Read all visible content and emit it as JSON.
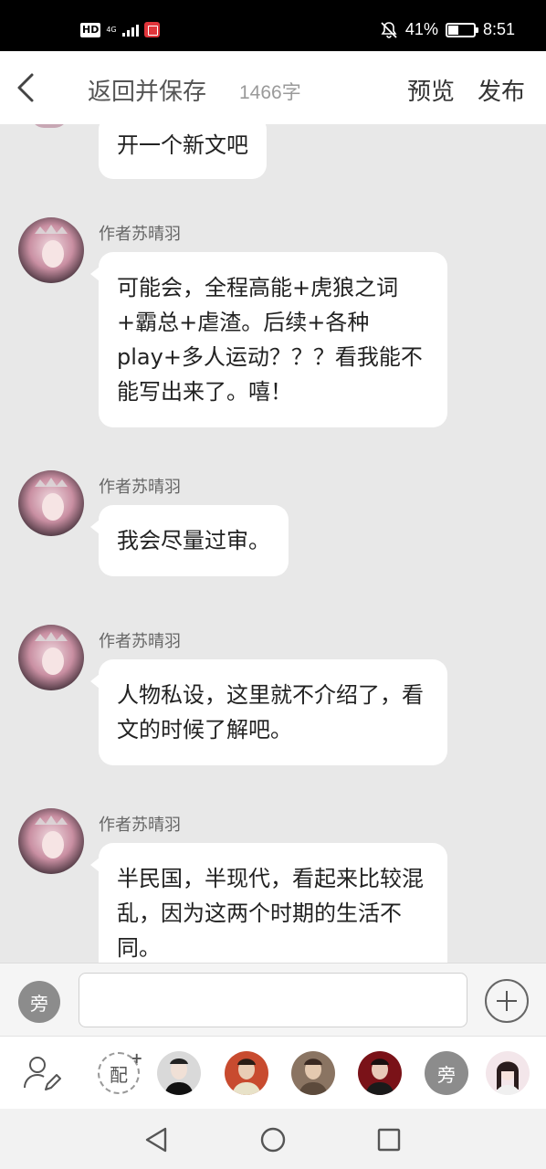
{
  "status_bar": {
    "hd_label": "HD",
    "network_label": "4G",
    "battery_percent": "41%",
    "battery_level": 0.41,
    "time": "8:51",
    "icons": [
      "hd-icon",
      "signal-icon",
      "notification-app-icon",
      "mute-bell-icon",
      "battery-icon"
    ]
  },
  "header": {
    "back_icon": "chevron-left-icon",
    "title": "返回并保存",
    "word_count": "1466字",
    "preview_label": "预览",
    "publish_label": "发布"
  },
  "chat": {
    "first_bubble": "开一个新文吧",
    "messages": [
      {
        "author": "作者苏晴羽",
        "text": "可能会，全程高能+虎狼之词+霸总+虐渣。后续+各种play+多人运动？？？看我能不能写出来了。嘻！"
      },
      {
        "author": "作者苏晴羽",
        "text": "我会尽量过审。"
      },
      {
        "author": "作者苏晴羽",
        "text": "人物私设，这里就不介绍了，看文的时候了解吧。"
      },
      {
        "author": "作者苏晴羽",
        "text": "半民国，半现代，看起来比较混乱，因为这两个时期的生活不同。"
      }
    ]
  },
  "input_bar": {
    "aside_label": "旁",
    "input_value": "",
    "plus_icon": "plus-circle-icon"
  },
  "character_row": {
    "edit_icon": "user-edit-icon",
    "peiyin_label": "配",
    "peiyin_plus": "+",
    "aside_label": "旁"
  },
  "nav_bar": {
    "icons": [
      "back-triangle-icon",
      "home-circle-icon",
      "recents-square-icon"
    ]
  },
  "colors": {
    "background": "#e8e8e8",
    "bubble": "#ffffff",
    "status_bar": "#000000",
    "aside_circle": "#8c8c8c"
  }
}
